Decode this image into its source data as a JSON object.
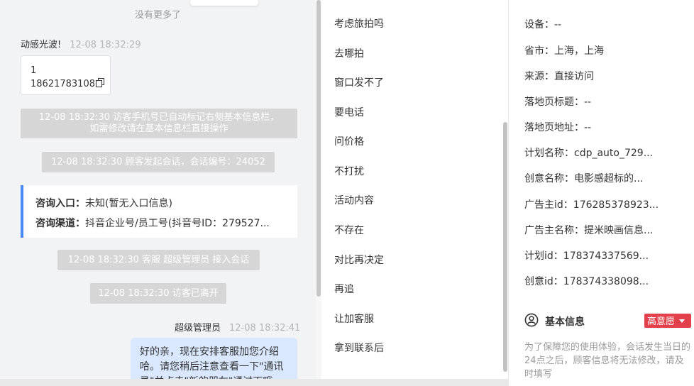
{
  "chat": {
    "no_more": "没有更多了",
    "visitor_name": "动感光波!",
    "visitor_time": "12-08 18:32:29",
    "phone_card": {
      "line1": "1",
      "line2": "18621783108"
    },
    "system_messages": [
      {
        "line1": "12-08 18:32:30 访客手机号已自动标记右侧基本信息栏，",
        "line2": "如需修改请在基本信息栏直接操作"
      },
      {
        "line1": "12-08 18:32:30 顾客发起会话，会话编号：24052"
      },
      {
        "line1": "12-08 18:32:30 客服 超级管理员 接入会话"
      },
      {
        "line1": "12-08 18:32:30 访客已离开"
      }
    ],
    "info_card": {
      "entry_label": "咨询入口：",
      "entry_value": "未知(暂无入口信息)",
      "channel_label": "咨询渠道：",
      "channel_value": "抖音企业号/员工号(抖音号ID：279527..."
    },
    "agent_name": "超级管理员",
    "agent_time": "12-08 18:32:41",
    "reply_text": "好的亲，现在安排客服加您介绍哈。请您稍后注意查看一下\"通讯录\"并点击\"新的朋友\"通过下哦"
  },
  "quick_replies": [
    "考虑旅拍吗",
    "去哪拍",
    "窗口发不了",
    "要电话",
    "问价格",
    "不打扰",
    "活动内容",
    "不存在",
    "对比再决定",
    "再追",
    "让加客服",
    "拿到联系后"
  ],
  "info_panel": {
    "fields": [
      {
        "label": "设备：",
        "value": "--"
      },
      {
        "label": "省市：",
        "value": "上海，上海"
      },
      {
        "label": "来源：",
        "value": "直接访问"
      },
      {
        "label": "落地页标题：",
        "value": "--"
      },
      {
        "label": "落地页地址：",
        "value": "--"
      },
      {
        "label": "计划名称：",
        "value": "cdp_auto_729..."
      },
      {
        "label": "创意名称：",
        "value": "电影感超标的..."
      },
      {
        "label": "广告主id：",
        "value": "176285378923..."
      },
      {
        "label": "广告主名称：",
        "value": "提米映画信息..."
      },
      {
        "label": "计划id：",
        "value": "178374337569..."
      },
      {
        "label": "创意id：",
        "value": "178374338098..."
      }
    ],
    "section_title": "基本信息",
    "intent_badge": "高意愿",
    "note": "为了保障您的使用体验，会话发生当日的24点之后，顾客信息将无法修改，请及时填写"
  },
  "colors": {
    "accent_blue": "#4a8af4",
    "badge_red": "#e2414c",
    "reply_bubble": "#d9e8ff",
    "system_msg_bg": "#d6d6d6"
  }
}
